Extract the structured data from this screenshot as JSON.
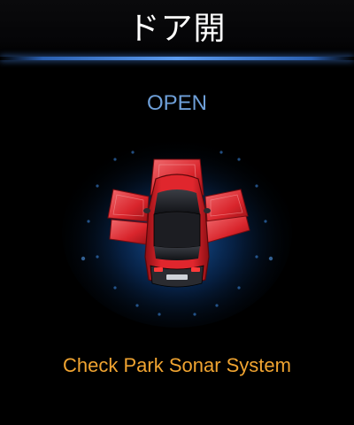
{
  "header": {
    "title": "ドア開"
  },
  "door_status": {
    "label": "OPEN",
    "open_doors": [
      "front-left",
      "front-right",
      "rear-left",
      "rear-right",
      "trunk"
    ]
  },
  "warning": {
    "message": "Check Park Sonar System"
  },
  "colors": {
    "status_text": "#6e9fd8",
    "warning_text": "#f0a431",
    "accent_line": "#5c9cf0",
    "car_body": "#d8232a",
    "open_door": "#e0333a"
  },
  "icons": {
    "vehicle": "car-top-view-icon"
  }
}
